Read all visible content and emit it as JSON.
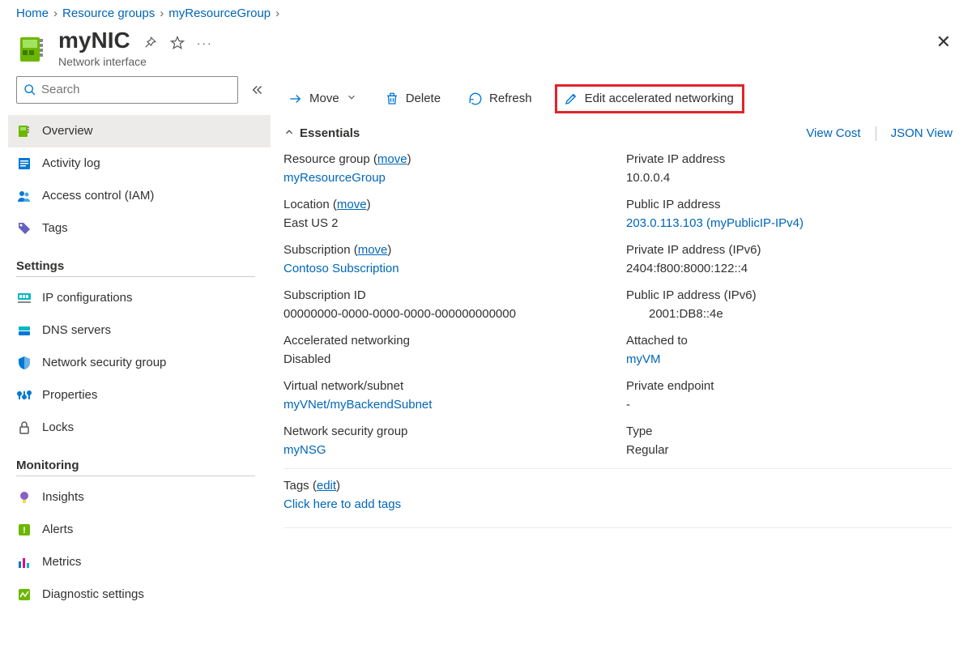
{
  "breadcrumb": [
    {
      "label": "Home"
    },
    {
      "label": "Resource groups"
    },
    {
      "label": "myResourceGroup"
    }
  ],
  "header": {
    "title": "myNIC",
    "subtitle": "Network interface"
  },
  "search": {
    "placeholder": "Search"
  },
  "sidebar": {
    "top": [
      {
        "label": "Overview",
        "icon": "nic-icon",
        "selected": true
      },
      {
        "label": "Activity log",
        "icon": "log-icon"
      },
      {
        "label": "Access control (IAM)",
        "icon": "people-icon"
      },
      {
        "label": "Tags",
        "icon": "tag-icon"
      }
    ],
    "sections": [
      {
        "title": "Settings",
        "items": [
          {
            "label": "IP configurations",
            "icon": "ipconfig-icon"
          },
          {
            "label": "DNS servers",
            "icon": "dns-icon"
          },
          {
            "label": "Network security group",
            "icon": "shield-icon"
          },
          {
            "label": "Properties",
            "icon": "props-icon"
          },
          {
            "label": "Locks",
            "icon": "lock-icon"
          }
        ]
      },
      {
        "title": "Monitoring",
        "items": [
          {
            "label": "Insights",
            "icon": "bulb-icon"
          },
          {
            "label": "Alerts",
            "icon": "alert-icon"
          },
          {
            "label": "Metrics",
            "icon": "metrics-icon"
          },
          {
            "label": "Diagnostic settings",
            "icon": "diag-icon"
          }
        ]
      }
    ]
  },
  "toolbar": {
    "move": "Move",
    "delete": "Delete",
    "refresh": "Refresh",
    "edit_accel": "Edit accelerated networking"
  },
  "essentials": {
    "toggle": "Essentials",
    "view_cost": "View Cost",
    "json_view": "JSON View",
    "left": [
      {
        "k": "Resource group",
        "move": "move",
        "v": "myResourceGroup",
        "link": true
      },
      {
        "k": "Location",
        "move": "move",
        "v": "East US 2"
      },
      {
        "k": "Subscription",
        "move": "move",
        "v": "Contoso Subscription",
        "link": true
      },
      {
        "k": "Subscription ID",
        "v": "00000000-0000-0000-0000-000000000000"
      },
      {
        "k": "Accelerated networking",
        "v": "Disabled"
      },
      {
        "k": "Virtual network/subnet",
        "v": "myVNet/myBackendSubnet",
        "link": true
      },
      {
        "k": "Network security group",
        "v": "myNSG",
        "link": true
      }
    ],
    "right": [
      {
        "k": "Private IP address",
        "v": "10.0.0.4"
      },
      {
        "k": "Public IP address",
        "v": "203.0.113.103 (myPublicIP-IPv4)",
        "link": true
      },
      {
        "k": "Private IP address (IPv6)",
        "v": "2404:f800:8000:122::4"
      },
      {
        "k": "Public IP address (IPv6)",
        "v": "2001:DB8::4e",
        "indent": true
      },
      {
        "k": "Attached to",
        "v": "myVM",
        "link": true
      },
      {
        "k": "Private endpoint",
        "v": "-"
      },
      {
        "k": "Type",
        "v": "Regular"
      }
    ],
    "tags": {
      "label_prefix": "Tags",
      "edit": "edit",
      "add": "Click here to add tags"
    }
  }
}
